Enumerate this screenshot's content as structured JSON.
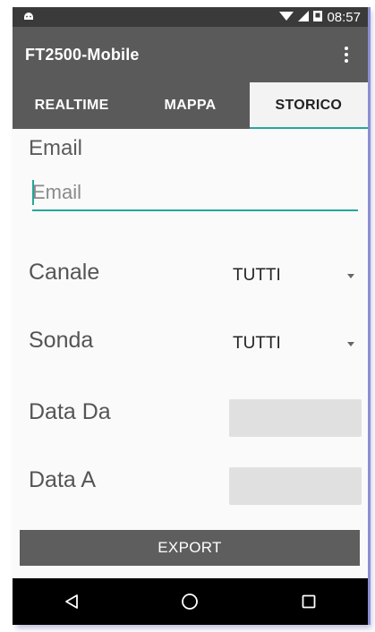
{
  "status_bar": {
    "time": "08:57"
  },
  "app": {
    "title": "FT2500-Mobile"
  },
  "tabs": [
    {
      "label": "REALTIME",
      "active": false
    },
    {
      "label": "MAPPA",
      "active": false
    },
    {
      "label": "STORICO",
      "active": true
    }
  ],
  "form": {
    "email_label": "Email",
    "email_placeholder": "Email",
    "canale_label": "Canale",
    "canale_value": "TUTTI",
    "sonda_label": "Sonda",
    "sonda_value": "TUTTI",
    "data_da_label": "Data Da",
    "data_a_label": "Data A",
    "export_label": "EXPORT"
  },
  "colors": {
    "accent": "#26a69a",
    "appbar": "#5a5a5a",
    "statusbar": "#3a3a3a"
  },
  "icons": [
    "android-icon",
    "wifi-icon",
    "signal-icon",
    "battery-icon",
    "overflow-menu-icon",
    "back-icon",
    "home-icon",
    "recents-icon"
  ]
}
